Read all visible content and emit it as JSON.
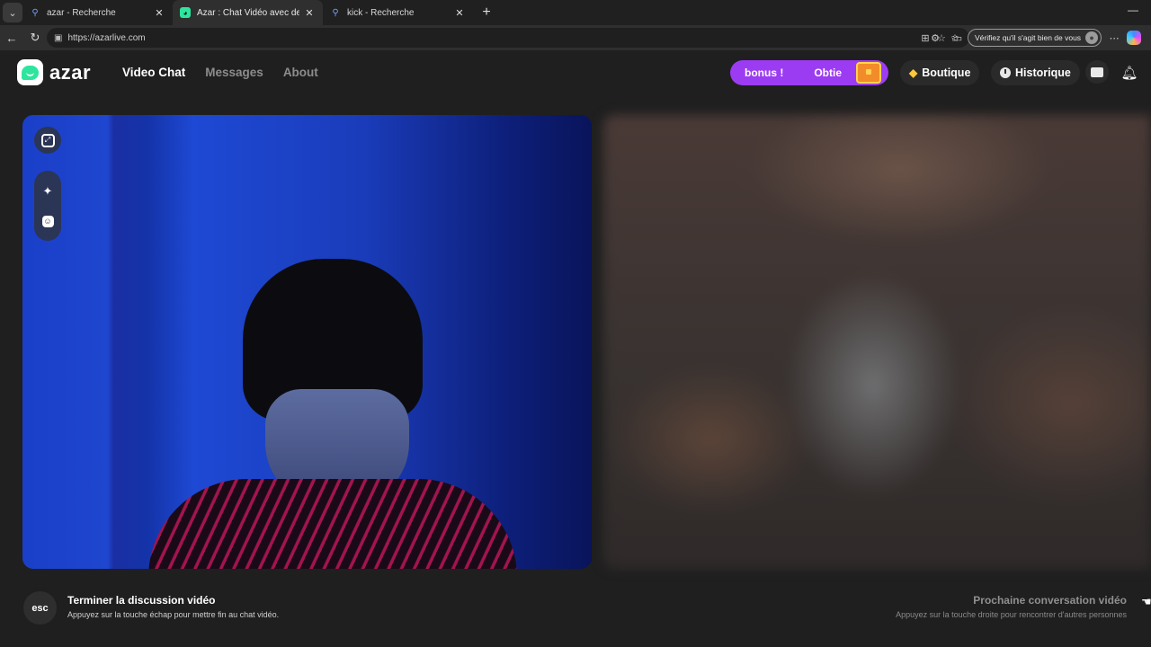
{
  "browser": {
    "tabs": [
      {
        "title": "azar - Recherche",
        "favicon": "search-icon"
      },
      {
        "title": "Azar : Chat Vidéo avec de nou",
        "favicon": "azar-logo-icon",
        "active": true
      },
      {
        "title": "kick - Recherche",
        "favicon": "search-icon"
      }
    ],
    "url": "https://azarlive.com",
    "profile_prompt": "Vérifiez qu'il s'agit bien de vous"
  },
  "site": {
    "logo_text": "azar",
    "nav": [
      "Video Chat",
      "Messages",
      "About"
    ],
    "bonus_part1": "bonus !",
    "bonus_part2": "Obtie",
    "boutique_label": "Boutique",
    "historique_label": "Historique",
    "accent_color": "#9b3cf2",
    "brand_color": "#2ee59d"
  },
  "footer": {
    "esc_key": "esc",
    "end_title": "Terminer la discussion vidéo",
    "end_sub": "Appuyez sur la touche échap pour mettre fin au chat vidéo.",
    "next_title": "Prochaine conversation vidéo",
    "next_sub": "Appuyez sur la touche droite pour rencontrer d'autres personnes"
  }
}
